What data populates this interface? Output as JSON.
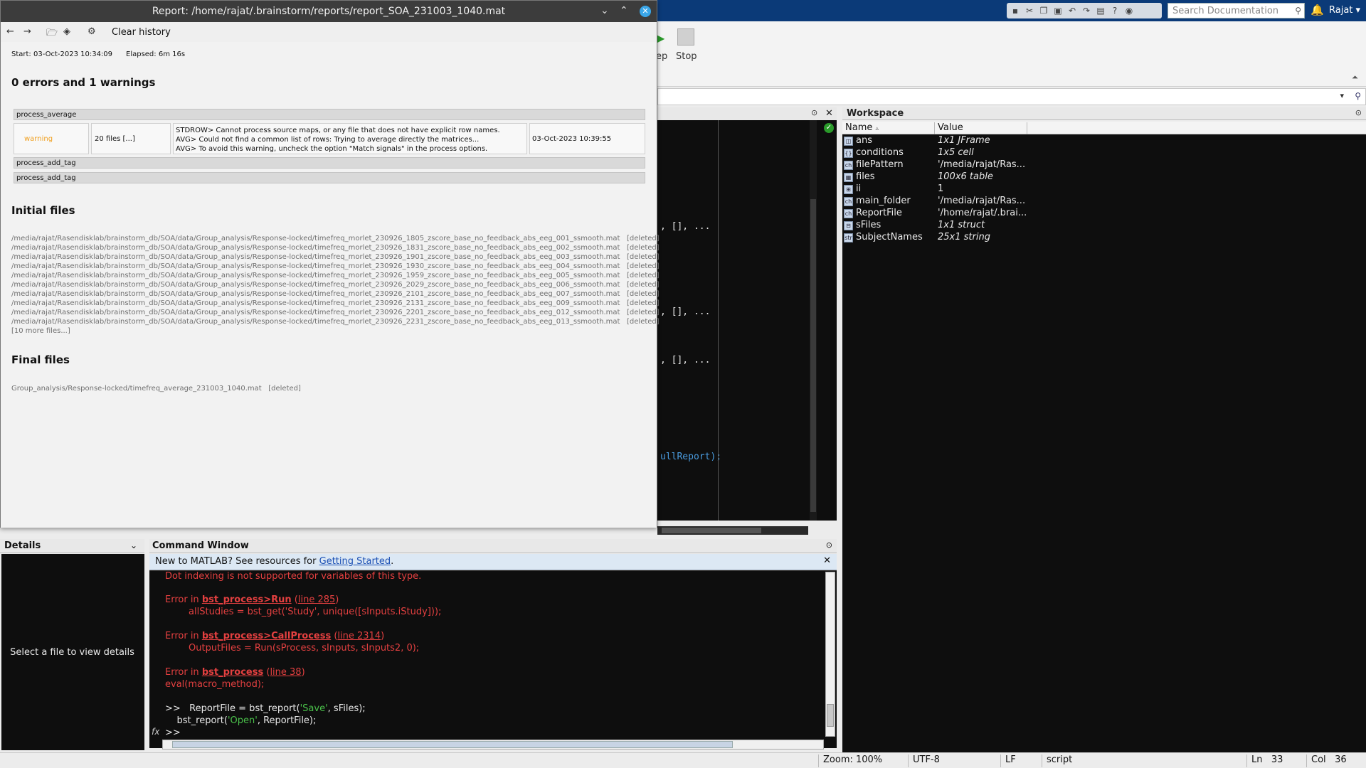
{
  "report_window": {
    "title": "Report: /home/rajat/.brainstorm/reports/report_SOA_231003_1040.mat",
    "toolbar": {
      "clear_history": "Clear history"
    },
    "start": "Start: 03-Oct-2023 10:34:09",
    "elapsed": "Elapsed: 6m 16s",
    "summary": "0 errors and 1 warnings",
    "processes": [
      {
        "name": "process_average"
      },
      {
        "name": "process_add_tag"
      },
      {
        "name": "process_add_tag"
      }
    ],
    "warning": {
      "level": "warning",
      "files": "20 files [...]",
      "messages": [
        "STDROW> Cannot process source maps, or any file that does not have explicit row names.",
        "AVG> Could not find a common list of rows: Trying to average directly the matrices...",
        "AVG> To avoid this warning, uncheck the option \"Match signals\" in the process options."
      ],
      "time": "03-Oct-2023 10:39:55"
    },
    "initial_files_title": "Initial files",
    "initial_files": [
      {
        "path": "/media/rajat/Rasendisklab/brainstorm_db/SOA/data/Group_analysis/Response-locked/timefreq_morlet_230926_1805_zscore_base_no_feedback_abs_eeg_001_ssmooth.mat",
        "status": "[deleted]"
      },
      {
        "path": "/media/rajat/Rasendisklab/brainstorm_db/SOA/data/Group_analysis/Response-locked/timefreq_morlet_230926_1831_zscore_base_no_feedback_abs_eeg_002_ssmooth.mat",
        "status": "[deleted]"
      },
      {
        "path": "/media/rajat/Rasendisklab/brainstorm_db/SOA/data/Group_analysis/Response-locked/timefreq_morlet_230926_1901_zscore_base_no_feedback_abs_eeg_003_ssmooth.mat",
        "status": "[deleted]"
      },
      {
        "path": "/media/rajat/Rasendisklab/brainstorm_db/SOA/data/Group_analysis/Response-locked/timefreq_morlet_230926_1930_zscore_base_no_feedback_abs_eeg_004_ssmooth.mat",
        "status": "[deleted]"
      },
      {
        "path": "/media/rajat/Rasendisklab/brainstorm_db/SOA/data/Group_analysis/Response-locked/timefreq_morlet_230926_1959_zscore_base_no_feedback_abs_eeg_005_ssmooth.mat",
        "status": "[deleted]"
      },
      {
        "path": "/media/rajat/Rasendisklab/brainstorm_db/SOA/data/Group_analysis/Response-locked/timefreq_morlet_230926_2029_zscore_base_no_feedback_abs_eeg_006_ssmooth.mat",
        "status": "[deleted]"
      },
      {
        "path": "/media/rajat/Rasendisklab/brainstorm_db/SOA/data/Group_analysis/Response-locked/timefreq_morlet_230926_2101_zscore_base_no_feedback_abs_eeg_007_ssmooth.mat",
        "status": "[deleted]"
      },
      {
        "path": "/media/rajat/Rasendisklab/brainstorm_db/SOA/data/Group_analysis/Response-locked/timefreq_morlet_230926_2131_zscore_base_no_feedback_abs_eeg_009_ssmooth.mat",
        "status": "[deleted]"
      },
      {
        "path": "/media/rajat/Rasendisklab/brainstorm_db/SOA/data/Group_analysis/Response-locked/timefreq_morlet_230926_2201_zscore_base_no_feedback_abs_eeg_012_ssmooth.mat",
        "status": "[deleted]"
      },
      {
        "path": "/media/rajat/Rasendisklab/brainstorm_db/SOA/data/Group_analysis/Response-locked/timefreq_morlet_230926_2231_zscore_base_no_feedback_abs_eeg_013_ssmooth.mat",
        "status": "[deleted]"
      }
    ],
    "more_files": "[10 more files...]",
    "final_files_title": "Final files",
    "final_file": {
      "path": "Group_analysis/Response-locked/timefreq_average_231003_1040.mat",
      "status": "[deleted]"
    }
  },
  "header": {
    "search_placeholder": "Search Documentation",
    "user": "Rajat"
  },
  "toolstrip": {
    "run_partial": "ep",
    "stop_label": "Stop"
  },
  "editor": {
    "frags": [
      ", [], ...",
      ", [], ...",
      ", [], ...",
      "ullReport);"
    ]
  },
  "workspace": {
    "title": "Workspace",
    "col_name": "Name",
    "col_value": "Value",
    "rows": [
      {
        "name": "ans",
        "value": "1x1 JFrame",
        "icon": "object-icon"
      },
      {
        "name": "conditions",
        "value": "1x5 cell",
        "icon": "cell-icon"
      },
      {
        "name": "filePattern",
        "value": "'/media/rajat/Ras...",
        "icon": "char-icon"
      },
      {
        "name": "files",
        "value": "100x6 table",
        "icon": "table-icon"
      },
      {
        "name": "ii",
        "value": "1",
        "icon": "numeric-icon"
      },
      {
        "name": "main_folder",
        "value": "'/media/rajat/Ras...",
        "icon": "char-icon"
      },
      {
        "name": "ReportFile",
        "value": "'/home/rajat/.brai...",
        "icon": "char-icon"
      },
      {
        "name": "sFiles",
        "value": "1x1 struct",
        "icon": "struct-icon"
      },
      {
        "name": "SubjectNames",
        "value": "25x1 string",
        "icon": "string-icon"
      }
    ]
  },
  "details": {
    "title": "Details",
    "placeholder": "Select a file to view details"
  },
  "command_window": {
    "title": "Command Window",
    "banner_text": "New to MATLAB? See resources for ",
    "banner_link": "Getting Started",
    "banner_end": ".",
    "lines": {
      "l0": "Dot indexing is not supported for variables of this type.",
      "e1_pre": "Error in ",
      "e1_fn": "bst_process>Run",
      "e1_line": "line 285",
      "e1_code": "        allStudies = bst_get('Study', unique([sInputs.iStudy]));",
      "e2_pre": "Error in ",
      "e2_fn": "bst_process>CallProcess",
      "e2_line": "line 2314",
      "e2_code": "        OutputFiles = Run(sProcess, sInputs, sInputs2, 0);",
      "e3_pre": "Error in ",
      "e3_fn": "bst_process",
      "e3_line": "line 38",
      "e3_code": "eval(macro_method);",
      "cmd1_a": ">>   ReportFile = bst_report(",
      "cmd1_s": "'Save'",
      "cmd1_b": ", sFiles);",
      "cmd2_a": "    bst_report(",
      "cmd2_s": "'Open'",
      "cmd2_b": ", ReportFile);",
      "prompt": ">>"
    }
  },
  "statusbar": {
    "zoom": "Zoom: 100%",
    "encoding": "UTF-8",
    "eol": "LF",
    "type": "script",
    "ln_label": "Ln",
    "ln_value": "33",
    "col_label": "Col",
    "col_value": "36"
  }
}
